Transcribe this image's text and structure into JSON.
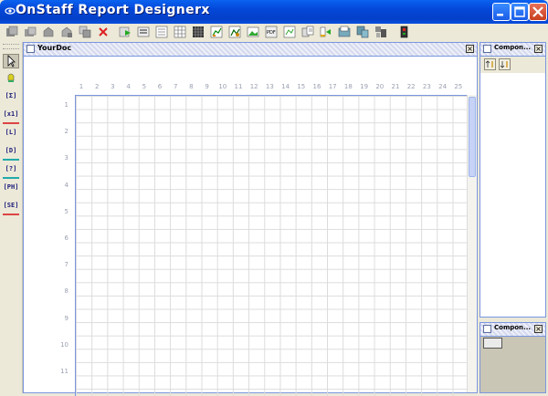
{
  "window": {
    "title": "OnStaff Report Designerx"
  },
  "toolbar": {
    "buttons": [
      "new-report",
      "open-report",
      "save",
      "save-as",
      "copy",
      "delete",
      "run",
      "preview",
      "form",
      "table",
      "grid",
      "chart-1",
      "chart-2",
      "image",
      "export",
      "frame",
      "import",
      "page-setup",
      "folder",
      "disk",
      "settings",
      "exit"
    ]
  },
  "palette": {
    "tools": [
      {
        "name": "select-tool",
        "label": ""
      },
      {
        "name": "bell-tool",
        "label": ""
      },
      {
        "name": "field-tool",
        "label": "[Σ]"
      },
      {
        "name": "expr-tool",
        "label": "[x1]"
      },
      {
        "name": "label-tool",
        "label": "[L]"
      },
      {
        "name": "date-tool",
        "label": "[D]"
      },
      {
        "name": "query-tool",
        "label": "[?]"
      },
      {
        "name": "pageheader-tool",
        "label": "[PH]"
      },
      {
        "name": "subreport-tool",
        "label": "[SE]"
      }
    ]
  },
  "document": {
    "title": "YourDoc",
    "columns": [
      "1",
      "2",
      "3",
      "4",
      "5",
      "6",
      "7",
      "8",
      "9",
      "10",
      "11",
      "12",
      "13",
      "14",
      "15",
      "16",
      "17",
      "18",
      "19",
      "20",
      "21",
      "22",
      "23",
      "24",
      "25"
    ],
    "rows": [
      "1",
      "2",
      "3",
      "4",
      "5",
      "6",
      "7",
      "8",
      "9",
      "10",
      "11"
    ]
  },
  "panels": {
    "top": {
      "title": "Compon..."
    },
    "bottom": {
      "title": "Compon..."
    }
  }
}
